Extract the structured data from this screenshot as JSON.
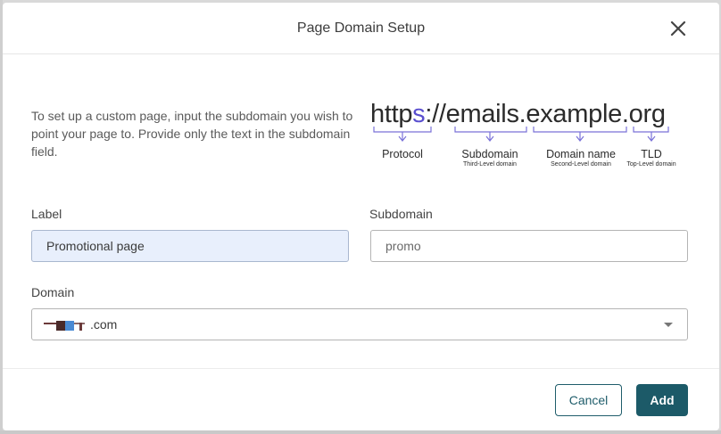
{
  "dialog": {
    "title": "Page Domain Setup",
    "close_icon": "close-icon"
  },
  "intro_text": "To set up a custom page, input the subdomain you wish to point your page to. Provide only the text in the subdomain field.",
  "url_example": {
    "prefix_a": "http",
    "prefix_highlight": "s",
    "rest": "://emails.example.org",
    "highlight_color": "#5a4fcf",
    "segments": [
      {
        "label": "Protocol",
        "sub": ""
      },
      {
        "label": "Subdomain",
        "sub": "Third-Level domain"
      },
      {
        "label": "Domain name",
        "sub": "Second-Level domain"
      },
      {
        "label": "TLD",
        "sub": "Top-Level domain"
      }
    ]
  },
  "form": {
    "label_field": {
      "label": "Label",
      "value": "Promotional page"
    },
    "subdomain_field": {
      "label": "Subdomain",
      "value": "promo"
    },
    "domain_field": {
      "label": "Domain",
      "suffix": ".com",
      "icon": "chevron-down-icon"
    }
  },
  "footer": {
    "cancel_label": "Cancel",
    "add_label": "Add",
    "primary_color": "#1c5a68"
  }
}
